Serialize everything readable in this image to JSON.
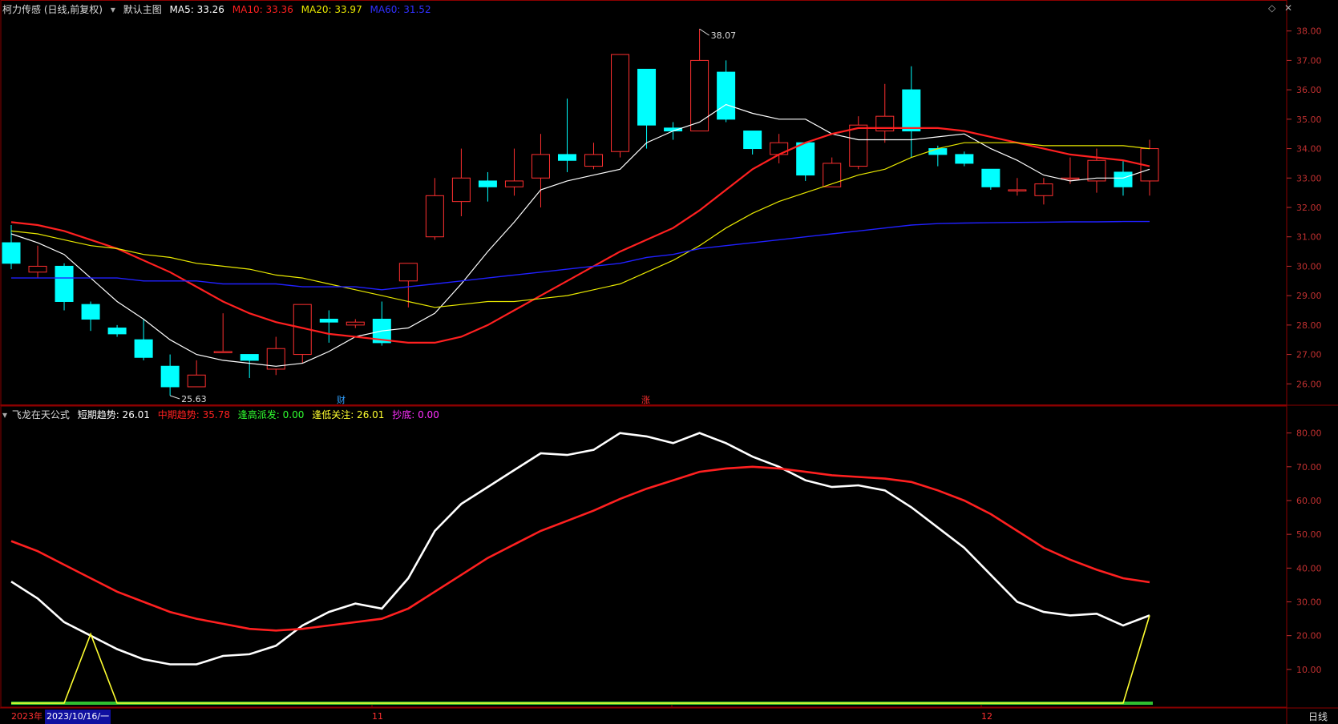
{
  "header": {
    "stock_name": "柯力传感 (日线,前复权)",
    "template_label": "默认主图",
    "ma5_label": "MA5: 33.26",
    "ma10_label": "MA10: 33.36",
    "ma20_label": "MA20: 33.97",
    "ma60_label": "MA60: 31.52"
  },
  "sub_header": {
    "formula_name": "飞龙在天公式",
    "short_label": "短期趋势: 26.01",
    "mid_label": "中期趋势: 35.78",
    "high_label": "逢高派发: 0.00",
    "low_label": "逢低关注: 26.01",
    "bottom_label": "抄底: 0.00"
  },
  "footer": {
    "year_label": "2023年",
    "date_label": "2023/10/16/一",
    "month_11": "11",
    "month_12": "12",
    "period_label": "日线"
  },
  "markers": {
    "cai": "财",
    "zhang": "涨"
  },
  "colors": {
    "up": "#ff3030",
    "down": "#00ffff",
    "ma5": "#ffffff",
    "ma10": "#ff2020",
    "ma20": "#e8e800",
    "ma60": "#2020ff",
    "short": "#ffffff",
    "mid": "#ff2020",
    "low": "#ffff30",
    "grid": "#8b0000",
    "axis": "#c03030"
  },
  "chart_data": [
    {
      "type": "candlestick",
      "title": "柯力传感 (日线,前复权)",
      "ylim": [
        25.3,
        38.4
      ],
      "y_ticks": [
        "26.00",
        "27.00",
        "28.00",
        "29.00",
        "30.00",
        "31.00",
        "32.00",
        "33.00",
        "34.00",
        "35.00",
        "36.00",
        "37.00",
        "38.00"
      ],
      "candles": [
        {
          "o": 30.8,
          "c": 30.1,
          "h": 31.4,
          "l": 29.9
        },
        {
          "o": 29.8,
          "c": 30.0,
          "h": 30.7,
          "l": 29.6
        },
        {
          "o": 30.0,
          "c": 28.8,
          "h": 30.1,
          "l": 28.5
        },
        {
          "o": 28.7,
          "c": 28.2,
          "h": 28.8,
          "l": 27.8
        },
        {
          "o": 27.9,
          "c": 27.7,
          "h": 28.0,
          "l": 27.6
        },
        {
          "o": 27.5,
          "c": 26.9,
          "h": 28.2,
          "l": 26.8
        },
        {
          "o": 26.6,
          "c": 25.9,
          "h": 27.0,
          "l": 25.6
        },
        {
          "o": 25.9,
          "c": 26.3,
          "h": 26.8,
          "l": 25.9
        },
        {
          "o": 27.1,
          "c": 27.1,
          "h": 28.4,
          "l": 27.1
        },
        {
          "o": 27.0,
          "c": 26.8,
          "h": 27.0,
          "l": 26.2
        },
        {
          "o": 26.5,
          "c": 27.2,
          "h": 27.6,
          "l": 26.3
        },
        {
          "o": 27.0,
          "c": 28.7,
          "h": 28.7,
          "l": 26.7
        },
        {
          "o": 28.2,
          "c": 28.1,
          "h": 28.5,
          "l": 27.4
        },
        {
          "o": 28.0,
          "c": 28.1,
          "h": 28.2,
          "l": 27.9
        },
        {
          "o": 28.2,
          "c": 27.4,
          "h": 28.8,
          "l": 27.3
        },
        {
          "o": 29.5,
          "c": 30.1,
          "h": 30.1,
          "l": 28.6
        },
        {
          "o": 31.0,
          "c": 32.4,
          "h": 33.0,
          "l": 30.9
        },
        {
          "o": 32.2,
          "c": 33.0,
          "h": 34.0,
          "l": 31.7
        },
        {
          "o": 32.9,
          "c": 32.7,
          "h": 33.2,
          "l": 32.2
        },
        {
          "o": 32.7,
          "c": 32.9,
          "h": 34.0,
          "l": 32.4
        },
        {
          "o": 33.0,
          "c": 33.8,
          "h": 34.5,
          "l": 32.0
        },
        {
          "o": 33.8,
          "c": 33.6,
          "h": 35.7,
          "l": 33.2
        },
        {
          "o": 33.4,
          "c": 33.8,
          "h": 34.2,
          "l": 33.3
        },
        {
          "o": 33.9,
          "c": 37.2,
          "h": 37.2,
          "l": 33.7
        },
        {
          "o": 36.7,
          "c": 34.8,
          "h": 36.7,
          "l": 34.0
        },
        {
          "o": 34.7,
          "c": 34.6,
          "h": 34.9,
          "l": 34.3
        },
        {
          "o": 34.6,
          "c": 37.0,
          "h": 38.07,
          "l": 34.6
        },
        {
          "o": 36.6,
          "c": 35.0,
          "h": 37.0,
          "l": 34.9
        },
        {
          "o": 34.6,
          "c": 34.0,
          "h": 34.6,
          "l": 33.8
        },
        {
          "o": 33.8,
          "c": 34.2,
          "h": 34.5,
          "l": 33.5
        },
        {
          "o": 34.2,
          "c": 33.1,
          "h": 34.2,
          "l": 32.9
        },
        {
          "o": 32.7,
          "c": 33.5,
          "h": 33.7,
          "l": 32.7
        },
        {
          "o": 33.4,
          "c": 34.8,
          "h": 35.1,
          "l": 33.3
        },
        {
          "o": 34.6,
          "c": 35.1,
          "h": 36.2,
          "l": 34.2
        },
        {
          "o": 36.0,
          "c": 34.6,
          "h": 36.8,
          "l": 33.7
        },
        {
          "o": 34.0,
          "c": 33.8,
          "h": 34.1,
          "l": 33.4
        },
        {
          "o": 33.8,
          "c": 33.5,
          "h": 33.9,
          "l": 33.4
        },
        {
          "o": 33.3,
          "c": 32.7,
          "h": 33.3,
          "l": 32.6
        },
        {
          "o": 32.6,
          "c": 32.6,
          "h": 33.0,
          "l": 32.4
        },
        {
          "o": 32.4,
          "c": 32.8,
          "h": 33.0,
          "l": 32.1
        },
        {
          "o": 33.0,
          "c": 33.0,
          "h": 33.7,
          "l": 32.8
        },
        {
          "o": 32.9,
          "c": 33.6,
          "h": 34.0,
          "l": 32.5
        },
        {
          "o": 33.2,
          "c": 32.7,
          "h": 33.6,
          "l": 32.4
        },
        {
          "o": 32.9,
          "c": 34.0,
          "h": 34.3,
          "l": 32.4
        }
      ],
      "series": [
        {
          "name": "MA5",
          "values": [
            31.1,
            30.8,
            30.4,
            29.6,
            28.8,
            28.2,
            27.5,
            27.0,
            26.8,
            26.7,
            26.6,
            26.7,
            27.1,
            27.6,
            27.8,
            27.9,
            28.4,
            29.4,
            30.5,
            31.5,
            32.6,
            32.9,
            33.1,
            33.3,
            34.2,
            34.6,
            34.9,
            35.5,
            35.2,
            35.0,
            35.0,
            34.5,
            34.3,
            34.3,
            34.3,
            34.4,
            34.5,
            34.0,
            33.6,
            33.1,
            32.9,
            33.0,
            33.0,
            33.3
          ]
        },
        {
          "name": "MA10",
          "values": [
            31.5,
            31.4,
            31.2,
            30.9,
            30.6,
            30.2,
            29.8,
            29.3,
            28.8,
            28.4,
            28.1,
            27.9,
            27.7,
            27.6,
            27.5,
            27.4,
            27.4,
            27.6,
            28.0,
            28.5,
            29.0,
            29.5,
            30.0,
            30.5,
            30.9,
            31.3,
            31.9,
            32.6,
            33.3,
            33.8,
            34.2,
            34.5,
            34.7,
            34.7,
            34.7,
            34.7,
            34.6,
            34.4,
            34.2,
            34.0,
            33.8,
            33.7,
            33.6,
            33.4
          ]
        },
        {
          "name": "MA20",
          "values": [
            31.2,
            31.1,
            30.9,
            30.7,
            30.6,
            30.4,
            30.3,
            30.1,
            30.0,
            29.9,
            29.7,
            29.6,
            29.4,
            29.2,
            29.0,
            28.8,
            28.6,
            28.7,
            28.8,
            28.8,
            28.9,
            29.0,
            29.2,
            29.4,
            29.8,
            30.2,
            30.7,
            31.3,
            31.8,
            32.2,
            32.5,
            32.8,
            33.1,
            33.3,
            33.7,
            34.0,
            34.2,
            34.2,
            34.2,
            34.1,
            34.1,
            34.1,
            34.1,
            34.0
          ]
        },
        {
          "name": "MA60",
          "values": [
            29.6,
            29.6,
            29.6,
            29.6,
            29.6,
            29.5,
            29.5,
            29.5,
            29.4,
            29.4,
            29.4,
            29.3,
            29.3,
            29.3,
            29.2,
            29.3,
            29.4,
            29.5,
            29.6,
            29.7,
            29.8,
            29.9,
            30.0,
            30.1,
            30.3,
            30.4,
            30.6,
            30.7,
            30.8,
            30.9,
            31.0,
            31.1,
            31.2,
            31.3,
            31.4,
            31.45,
            31.47,
            31.48,
            31.49,
            31.5,
            31.51,
            31.51,
            31.52,
            31.52
          ]
        }
      ],
      "annotations": [
        {
          "label": "38.07",
          "index": 26
        },
        {
          "label": "25.63",
          "index": 6
        }
      ]
    },
    {
      "type": "line",
      "title": "飞龙在天公式",
      "ylim": [
        0,
        83
      ],
      "y_ticks": [
        "10.00",
        "20.00",
        "30.00",
        "40.00",
        "50.00",
        "60.00",
        "70.00",
        "80.00"
      ],
      "series": [
        {
          "name": "短期趋势",
          "values": [
            36,
            31,
            24,
            20,
            16,
            13,
            11.5,
            11.5,
            14,
            14.5,
            17,
            23,
            27,
            29.5,
            28,
            37,
            51,
            59,
            64,
            69,
            74,
            73.5,
            75,
            80,
            79,
            77,
            80,
            77,
            73,
            70,
            66,
            64,
            64.5,
            63,
            58,
            52,
            46,
            38,
            30,
            27,
            26,
            26.5,
            23,
            26
          ]
        },
        {
          "name": "中期趋势",
          "values": [
            48,
            45,
            41,
            37,
            33,
            30,
            27,
            25,
            23.5,
            22,
            21.5,
            22,
            23,
            24,
            25,
            28,
            33,
            38,
            43,
            47,
            51,
            54,
            57,
            60.5,
            63.5,
            66,
            68.5,
            69.5,
            70,
            69.5,
            68.5,
            67.5,
            67,
            66.5,
            65.5,
            63,
            60,
            56,
            51,
            46,
            42.5,
            39.5,
            37,
            35.8
          ]
        },
        {
          "name": "逢低关注",
          "values": [
            0,
            0,
            0,
            20.5,
            0,
            0,
            0,
            0,
            0,
            0,
            0,
            0,
            0,
            0,
            0,
            0,
            0,
            0,
            0,
            0,
            0,
            0,
            0,
            0,
            0,
            0,
            0,
            0,
            0,
            0,
            0,
            0,
            0,
            0,
            0,
            0,
            0,
            0,
            0,
            0,
            0,
            0,
            0,
            26
          ]
        }
      ]
    }
  ]
}
